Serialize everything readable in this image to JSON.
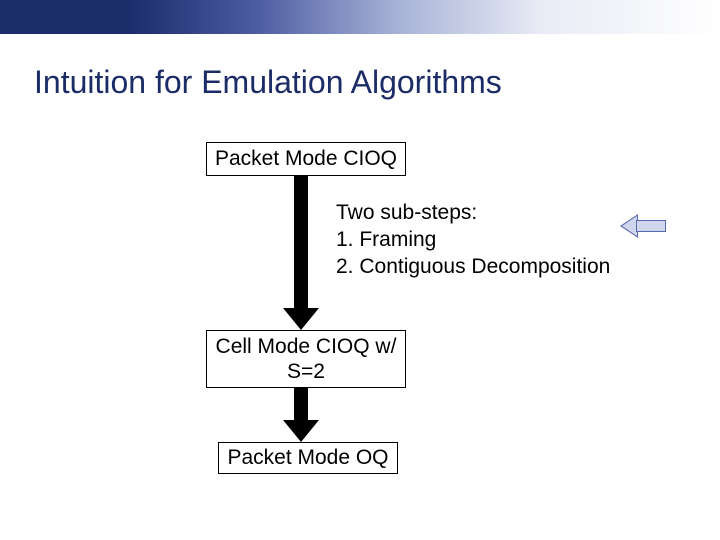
{
  "title": "Intuition for Emulation Algorithms",
  "boxes": {
    "top": "Packet Mode CIOQ",
    "middle_line1": "Cell Mode CIOQ w/",
    "middle_line2": "S=2",
    "bottom": "Packet Mode OQ"
  },
  "substeps": {
    "header": "Two sub-steps:",
    "step1": "1. Framing",
    "step2": "2. Contiguous Decomposition"
  }
}
